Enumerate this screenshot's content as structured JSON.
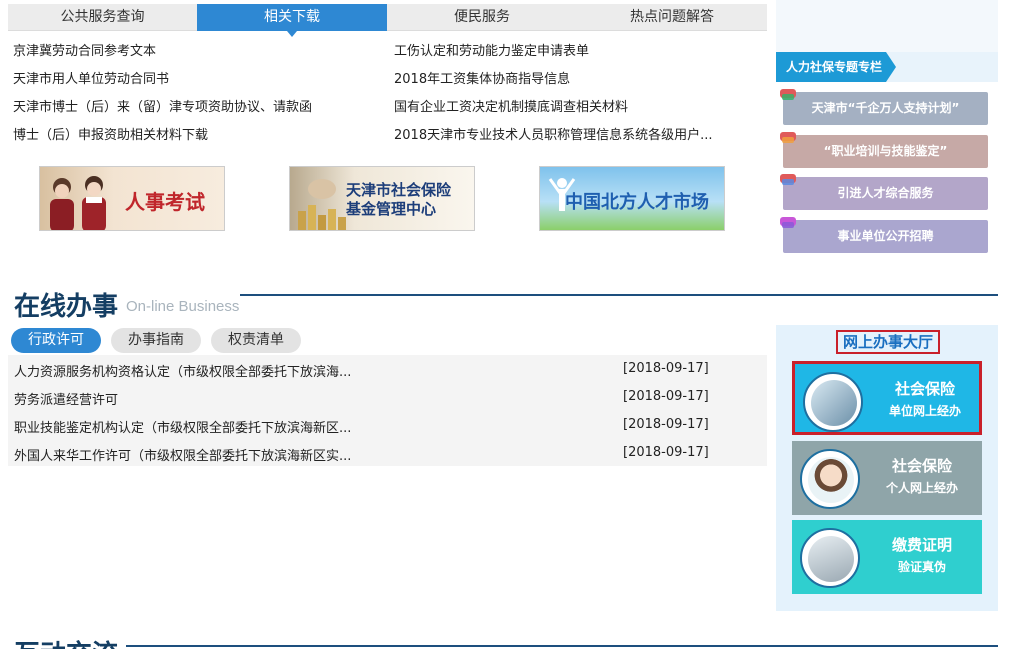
{
  "tabs": [
    "公共服务查询",
    "相关下载",
    "便民服务",
    "热点问题解答"
  ],
  "downloads": [
    "京津冀劳动合同参考文本",
    "工伤认定和劳动能力鉴定申请表单",
    "天津市用人单位劳动合同书",
    "2018年工资集体协商指导信息",
    "天津市博士（后）来（留）津专项资助协议、请款函",
    "国有企业工资决定机制摸底调查相关材料",
    "博士（后）申报资助相关材料下载",
    "2018天津市专业技术人员职称管理信息系统各级用户..."
  ],
  "banners": {
    "exam": "人事考试",
    "fund_line1": "天津市社会保险",
    "fund_line2": "基金管理中心",
    "talent": "中国北方人才市场"
  },
  "sidebar": {
    "header": "人力社保专题专栏",
    "items": [
      "天津市“千企万人支持计划”",
      "“职业培训与技能鉴定”",
      "引进人才综合服务",
      "事业单位公开招聘"
    ]
  },
  "online": {
    "title": "在线办事",
    "subtitle": "On-line Business",
    "tabs": [
      "行政许可",
      "办事指南",
      "权责清单"
    ],
    "rows": [
      {
        "title": "人力资源服务机构资格认定（市级权限全部委托下放滨海...",
        "date": "[2018-09-17]"
      },
      {
        "title": "劳务派遣经营许可",
        "date": "[2018-09-17]"
      },
      {
        "title": "职业技能鉴定机构认定（市级权限全部委托下放滨海新区...",
        "date": "[2018-09-17]"
      },
      {
        "title": "外国人来华工作许可（市级权限全部委托下放滨海新区实...",
        "date": "[2018-09-17]"
      }
    ]
  },
  "hall": {
    "title": "网上办事大厅",
    "buttons": [
      {
        "line1": "社会保险",
        "line2": "单位网上经办"
      },
      {
        "line1": "社会保险",
        "line2": "个人网上经办"
      },
      {
        "line1": "缴费证明",
        "line2": "验证真伪"
      }
    ]
  },
  "next_section_title": "互动交流",
  "colors": {
    "accent": "#2e88d3",
    "heading": "#143e63",
    "hall_highlight": "#c9202a"
  }
}
